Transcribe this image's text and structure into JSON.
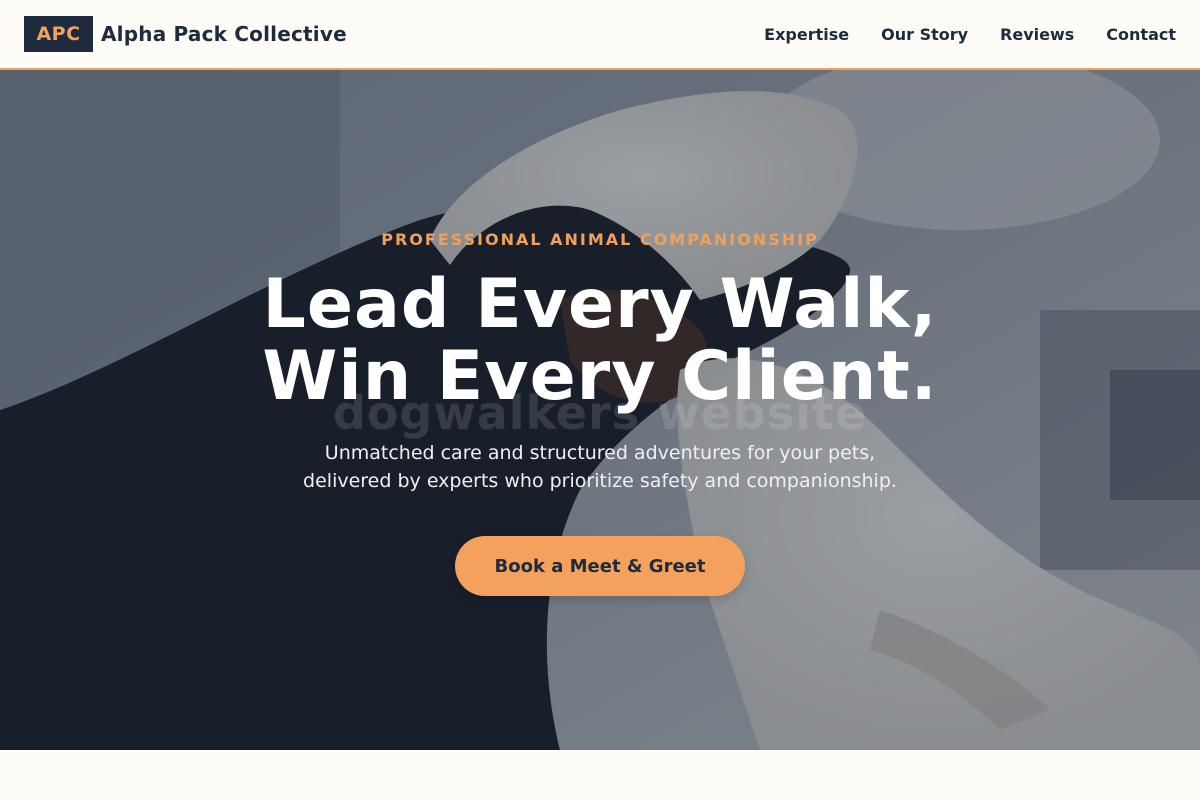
{
  "header": {
    "logo_text": "APC",
    "brand_name": "Alpha Pack Collective",
    "nav": [
      {
        "label": "Expertise"
      },
      {
        "label": "Our Story"
      },
      {
        "label": "Reviews"
      },
      {
        "label": "Contact"
      }
    ]
  },
  "hero": {
    "eyebrow": "PROFESSIONAL ANIMAL COMPANIONSHIP",
    "headline_line1": "Lead Every Walk,",
    "headline_line2": "Win Every Client.",
    "watermark": "dogwalkers website",
    "subtext_line1": "Unmatched care and structured adventures for your pets,",
    "subtext_line2": "delivered by experts who prioritize safety and companionship.",
    "cta_label": "Book a Meet & Greet",
    "background_image": "dog-with-gloved-hands-photo"
  },
  "colors": {
    "navy": "#1e2a3d",
    "accent_orange": "#f3a15d",
    "cream": "#fdfdf7",
    "white": "#ffffff"
  }
}
